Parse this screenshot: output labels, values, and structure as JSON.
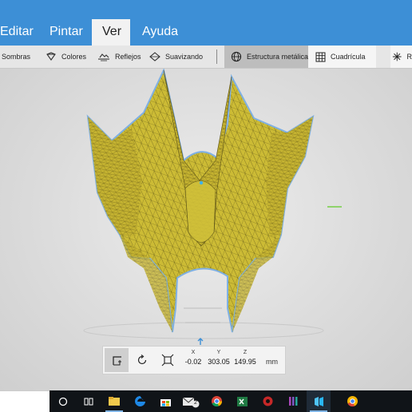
{
  "menu": {
    "tabs": [
      {
        "label": "Editar"
      },
      {
        "label": "Pintar"
      },
      {
        "label": "Ver"
      },
      {
        "label": "Ayuda"
      }
    ]
  },
  "toolbar": {
    "items": [
      {
        "label": "Sombras",
        "icon": "shading-icon"
      },
      {
        "label": "Colores",
        "icon": "paint-bucket-icon"
      },
      {
        "label": "Reflejos",
        "icon": "reflections-icon"
      },
      {
        "label": "Suavizando",
        "icon": "smoothing-icon"
      },
      {
        "label": "Estructura metálica",
        "icon": "wireframe-globe-icon",
        "selected": true
      },
      {
        "label": "Cuadrícula",
        "icon": "grid-icon"
      },
      {
        "label": "R",
        "icon": "sparkle-icon"
      }
    ]
  },
  "transform": {
    "x_label": "X",
    "y_label": "Y",
    "z_label": "Z",
    "x": "-0.02",
    "y": "303.05",
    "z": "149.95",
    "unit": "mm"
  },
  "taskbar": {
    "apps": [
      "start-circle-icon",
      "task-view-icon",
      "file-explorer-icon",
      "edge-icon",
      "store-icon",
      "mail-icon",
      "chrome-icon",
      "excel-icon",
      "media-app-icon",
      "visual-studio-icon",
      "3d-builder-icon",
      "chrome-canary-icon"
    ],
    "mail_badge": "2"
  },
  "colors": {
    "accent": "#3d8fd6",
    "model_fill": "#c9b832",
    "model_outline": "#7fb0e3"
  }
}
